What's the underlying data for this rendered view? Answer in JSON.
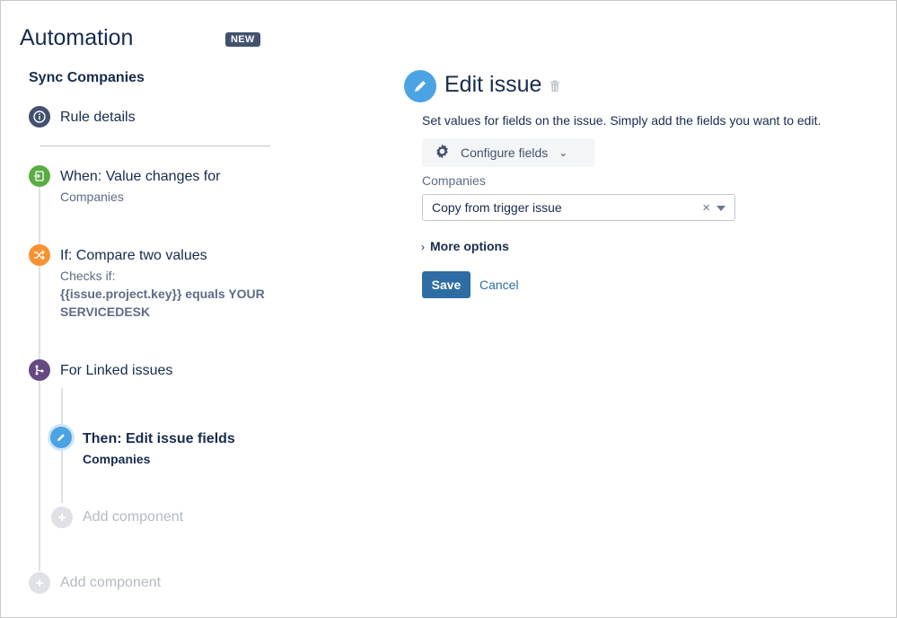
{
  "header": {
    "title": "Automation",
    "badge": "NEW"
  },
  "rule": {
    "name": "Sync Companies",
    "details_label": "Rule details",
    "steps": [
      {
        "title": "When: Value changes for",
        "sub": "Companies",
        "icon": "trigger-icon",
        "color": "#5aac44"
      },
      {
        "title": "If: Compare two values",
        "sub_prefix": "Checks if:",
        "sub_bold": "{{issue.project.key}} equals YOUR SERVICEDESK",
        "icon": "shuffle-icon",
        "color": "#f79233"
      },
      {
        "title": "For Linked issues",
        "icon": "branch-icon",
        "color": "#654982"
      }
    ],
    "nested_action": {
      "title": "Then: Edit issue fields",
      "sub": "Companies",
      "icon": "pencil-icon",
      "color": "#4ba3e3"
    },
    "add_component_inner": "Add component",
    "add_component_outer": "Add component"
  },
  "editor": {
    "title": "Edit issue",
    "description": "Set values for fields on the issue. Simply add the fields you want to edit.",
    "configure_label": "Configure fields",
    "field_label": "Companies",
    "field_value": "Copy from trigger issue",
    "more_options": "More options",
    "save": "Save",
    "cancel": "Cancel"
  }
}
